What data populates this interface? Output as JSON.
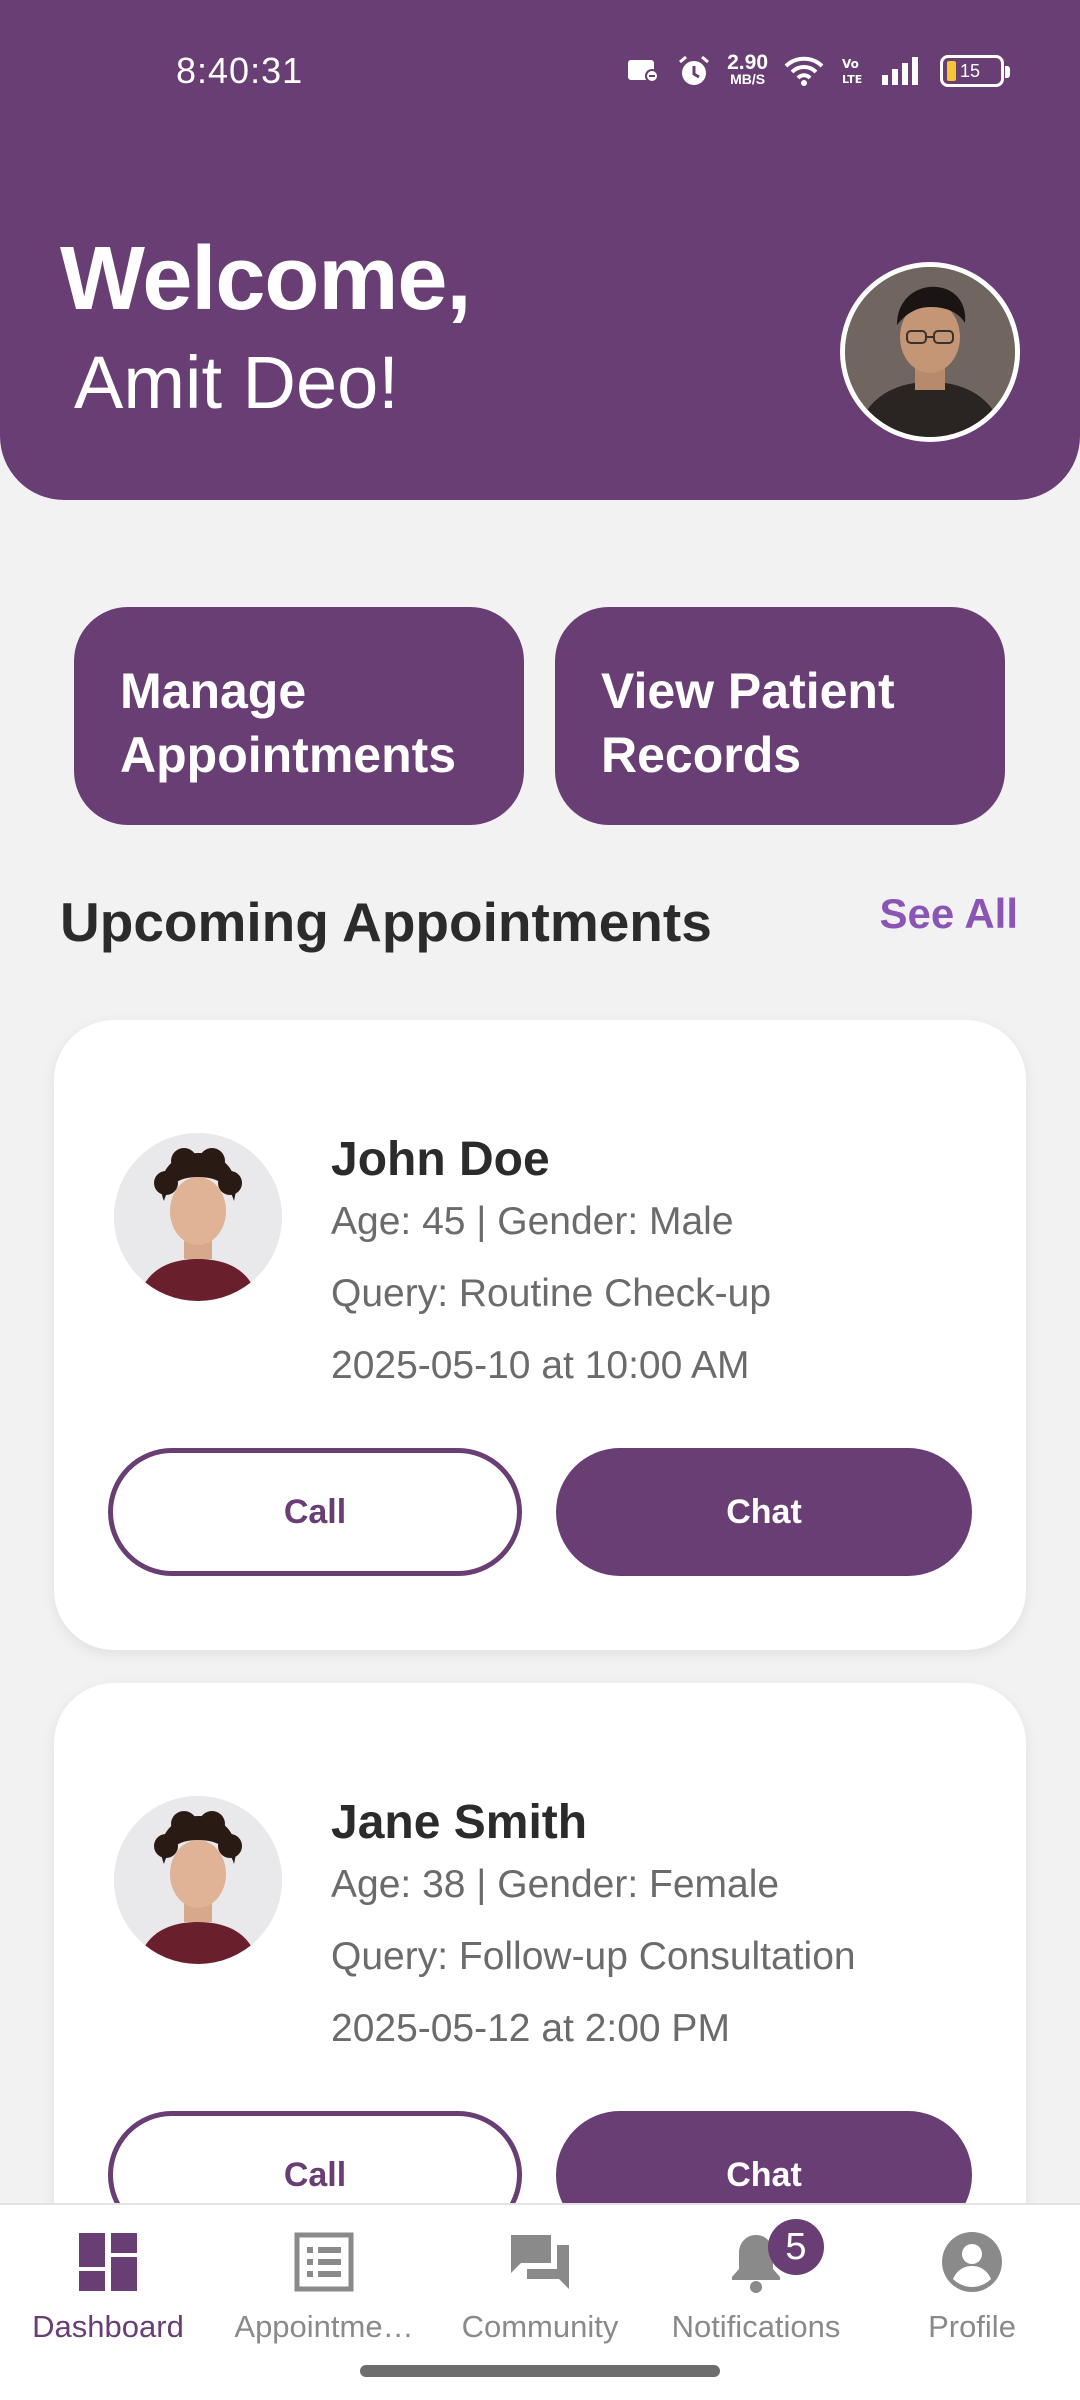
{
  "status_bar": {
    "time": "8:40:31",
    "net_speed_value": "2.90",
    "net_speed_unit": "MB/S",
    "battery_level": "15",
    "icons": [
      "card-icon",
      "alarm-icon",
      "wifi-icon",
      "volte-icon",
      "signal-icon",
      "battery-icon"
    ]
  },
  "header": {
    "welcome": "Welcome,",
    "user_name": "Amit Deo!"
  },
  "quick_actions": [
    {
      "line1": "Manage",
      "line2": "Appointments"
    },
    {
      "line1": "View Patient",
      "line2": "Records"
    }
  ],
  "section": {
    "title": "Upcoming Appointments",
    "see_all": "See All"
  },
  "appointments": [
    {
      "name": "John Doe",
      "info": "Age: 45 | Gender: Male",
      "query": "Query: Routine Check-up",
      "datetime": "2025-05-10 at 10:00 AM",
      "call": "Call",
      "chat": "Chat"
    },
    {
      "name": "Jane Smith",
      "info": "Age: 38 | Gender: Female",
      "query": "Query: Follow-up Consultation",
      "datetime": "2025-05-12 at 2:00 PM",
      "call": "Call",
      "chat": "Chat"
    }
  ],
  "bottom_nav": [
    {
      "label": "Dashboard",
      "icon": "dashboard-icon",
      "active": true
    },
    {
      "label": "Appointme…",
      "icon": "list-icon",
      "active": false
    },
    {
      "label": "Community",
      "icon": "chat-bubbles-icon",
      "active": false
    },
    {
      "label": "Notifications",
      "icon": "bell-icon",
      "active": false,
      "badge": "5"
    },
    {
      "label": "Profile",
      "icon": "account-circle-icon",
      "active": false
    }
  ],
  "colors": {
    "primary": "#683e74",
    "accent_link": "#8b55b6",
    "background": "#f3f2f3",
    "inactive_nav": "#8a8a8a"
  }
}
